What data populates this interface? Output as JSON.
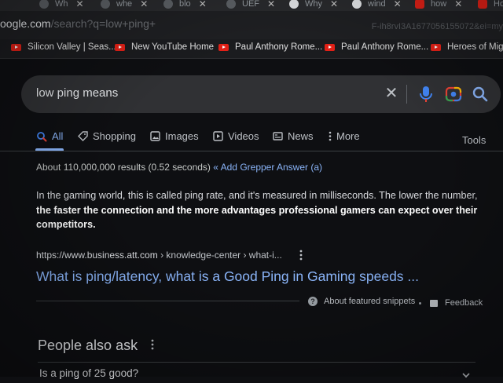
{
  "tabs": [
    {
      "label": "Wh",
      "icon": "globe-icon"
    },
    {
      "label": "whe",
      "icon": "globe-icon"
    },
    {
      "label": "blo",
      "icon": "globe-icon"
    },
    {
      "label": "UEF",
      "icon": "app-icon"
    },
    {
      "label": "Why",
      "icon": "google-icon"
    },
    {
      "label": "wind",
      "icon": "google-icon"
    },
    {
      "label": "how",
      "icon": "youtube-icon"
    },
    {
      "label": "Ho",
      "icon": "youtube-icon"
    }
  ],
  "address": {
    "host": "oogle.com",
    "path": "/search?q=low+ping+",
    "right": "F-ih8rvI3A1677056155072&ei=my"
  },
  "bookmarks": [
    "Silicon Valley | Seas...",
    "New YouTube Home",
    "Paul Anthony Rome...",
    "Paul Anthony Rome...",
    "Heroes of Migh"
  ],
  "search": {
    "query": "low ping means"
  },
  "filters": {
    "all": "All",
    "shopping": "Shopping",
    "images": "Images",
    "videos": "Videos",
    "news": "News",
    "more": "More",
    "tools": "Tools"
  },
  "stats": {
    "text": "About 110,000,000 results (0.52 seconds)",
    "grepper": "« Add Grepper Answer (a)"
  },
  "snippet": {
    "plain": "In the gaming world, this is called ping rate, and it's measured in milliseconds. The lower the number, ",
    "bold": "the faster the connection and the more advantages professional gamers can expect over their competitors",
    "end": ".",
    "cite_host": "https://www.business.att.com",
    "cite_path": " › knowledge-center › what-i...",
    "title": "What is ping/latency, what is a Good Ping in Gaming speeds ...",
    "about": "About featured snippets",
    "feedback": "Feedback"
  },
  "paa": {
    "title": "People also ask",
    "first_question": "Is a ping of 25 good?"
  },
  "colors": {
    "background": "#0e0f12",
    "link": "#8ab4f8",
    "text": "#bdc1c6",
    "search_box": "#303134"
  }
}
